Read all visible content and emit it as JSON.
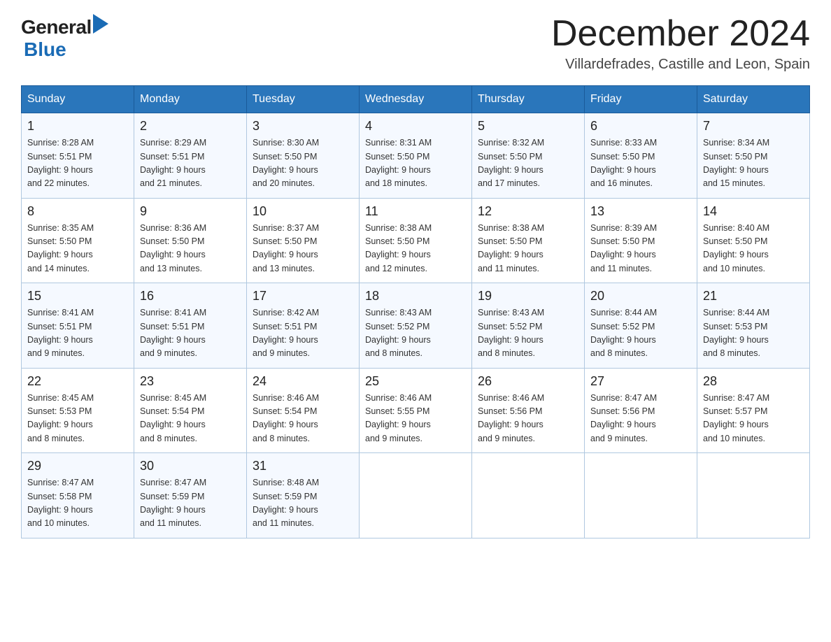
{
  "header": {
    "logo_general": "General",
    "logo_blue": "Blue",
    "month_title": "December 2024",
    "location": "Villardefrades, Castille and Leon, Spain"
  },
  "days_of_week": [
    "Sunday",
    "Monday",
    "Tuesday",
    "Wednesday",
    "Thursday",
    "Friday",
    "Saturday"
  ],
  "weeks": [
    [
      {
        "day": "1",
        "sunrise": "8:28 AM",
        "sunset": "5:51 PM",
        "daylight": "9 hours and 22 minutes."
      },
      {
        "day": "2",
        "sunrise": "8:29 AM",
        "sunset": "5:51 PM",
        "daylight": "9 hours and 21 minutes."
      },
      {
        "day": "3",
        "sunrise": "8:30 AM",
        "sunset": "5:50 PM",
        "daylight": "9 hours and 20 minutes."
      },
      {
        "day": "4",
        "sunrise": "8:31 AM",
        "sunset": "5:50 PM",
        "daylight": "9 hours and 18 minutes."
      },
      {
        "day": "5",
        "sunrise": "8:32 AM",
        "sunset": "5:50 PM",
        "daylight": "9 hours and 17 minutes."
      },
      {
        "day": "6",
        "sunrise": "8:33 AM",
        "sunset": "5:50 PM",
        "daylight": "9 hours and 16 minutes."
      },
      {
        "day": "7",
        "sunrise": "8:34 AM",
        "sunset": "5:50 PM",
        "daylight": "9 hours and 15 minutes."
      }
    ],
    [
      {
        "day": "8",
        "sunrise": "8:35 AM",
        "sunset": "5:50 PM",
        "daylight": "9 hours and 14 minutes."
      },
      {
        "day": "9",
        "sunrise": "8:36 AM",
        "sunset": "5:50 PM",
        "daylight": "9 hours and 13 minutes."
      },
      {
        "day": "10",
        "sunrise": "8:37 AM",
        "sunset": "5:50 PM",
        "daylight": "9 hours and 13 minutes."
      },
      {
        "day": "11",
        "sunrise": "8:38 AM",
        "sunset": "5:50 PM",
        "daylight": "9 hours and 12 minutes."
      },
      {
        "day": "12",
        "sunrise": "8:38 AM",
        "sunset": "5:50 PM",
        "daylight": "9 hours and 11 minutes."
      },
      {
        "day": "13",
        "sunrise": "8:39 AM",
        "sunset": "5:50 PM",
        "daylight": "9 hours and 11 minutes."
      },
      {
        "day": "14",
        "sunrise": "8:40 AM",
        "sunset": "5:50 PM",
        "daylight": "9 hours and 10 minutes."
      }
    ],
    [
      {
        "day": "15",
        "sunrise": "8:41 AM",
        "sunset": "5:51 PM",
        "daylight": "9 hours and 9 minutes."
      },
      {
        "day": "16",
        "sunrise": "8:41 AM",
        "sunset": "5:51 PM",
        "daylight": "9 hours and 9 minutes."
      },
      {
        "day": "17",
        "sunrise": "8:42 AM",
        "sunset": "5:51 PM",
        "daylight": "9 hours and 9 minutes."
      },
      {
        "day": "18",
        "sunrise": "8:43 AM",
        "sunset": "5:52 PM",
        "daylight": "9 hours and 8 minutes."
      },
      {
        "day": "19",
        "sunrise": "8:43 AM",
        "sunset": "5:52 PM",
        "daylight": "9 hours and 8 minutes."
      },
      {
        "day": "20",
        "sunrise": "8:44 AM",
        "sunset": "5:52 PM",
        "daylight": "9 hours and 8 minutes."
      },
      {
        "day": "21",
        "sunrise": "8:44 AM",
        "sunset": "5:53 PM",
        "daylight": "9 hours and 8 minutes."
      }
    ],
    [
      {
        "day": "22",
        "sunrise": "8:45 AM",
        "sunset": "5:53 PM",
        "daylight": "9 hours and 8 minutes."
      },
      {
        "day": "23",
        "sunrise": "8:45 AM",
        "sunset": "5:54 PM",
        "daylight": "9 hours and 8 minutes."
      },
      {
        "day": "24",
        "sunrise": "8:46 AM",
        "sunset": "5:54 PM",
        "daylight": "9 hours and 8 minutes."
      },
      {
        "day": "25",
        "sunrise": "8:46 AM",
        "sunset": "5:55 PM",
        "daylight": "9 hours and 9 minutes."
      },
      {
        "day": "26",
        "sunrise": "8:46 AM",
        "sunset": "5:56 PM",
        "daylight": "9 hours and 9 minutes."
      },
      {
        "day": "27",
        "sunrise": "8:47 AM",
        "sunset": "5:56 PM",
        "daylight": "9 hours and 9 minutes."
      },
      {
        "day": "28",
        "sunrise": "8:47 AM",
        "sunset": "5:57 PM",
        "daylight": "9 hours and 10 minutes."
      }
    ],
    [
      {
        "day": "29",
        "sunrise": "8:47 AM",
        "sunset": "5:58 PM",
        "daylight": "9 hours and 10 minutes."
      },
      {
        "day": "30",
        "sunrise": "8:47 AM",
        "sunset": "5:59 PM",
        "daylight": "9 hours and 11 minutes."
      },
      {
        "day": "31",
        "sunrise": "8:48 AM",
        "sunset": "5:59 PM",
        "daylight": "9 hours and 11 minutes."
      },
      null,
      null,
      null,
      null
    ]
  ],
  "labels": {
    "sunrise": "Sunrise:",
    "sunset": "Sunset:",
    "daylight": "Daylight:"
  }
}
